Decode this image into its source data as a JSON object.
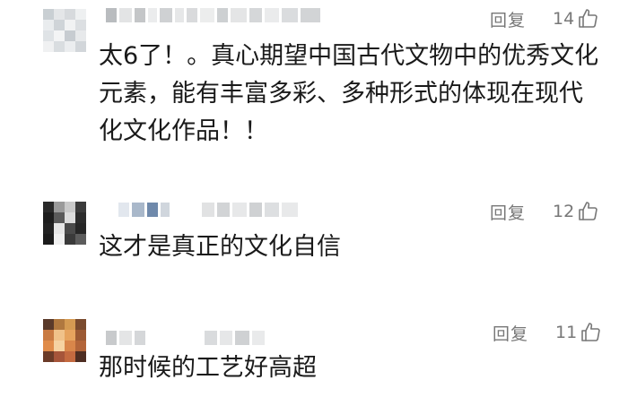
{
  "comments": [
    {
      "text": "太6了！。真心期望中国古代文物中的优秀文化元素，能有丰富多彩、多种形式的体现在现代化文化作品！！",
      "reply_label": "回复",
      "likes": "14"
    },
    {
      "text": "这才是真正的文化自信",
      "reply_label": "回复",
      "likes": "12"
    },
    {
      "text": "那时候的工艺好高超",
      "reply_label": "回复",
      "likes": "11"
    }
  ],
  "icons": {
    "like": "thumbs-up-icon"
  },
  "colors": {
    "text": "#1a1a1a",
    "meta": "#777777"
  }
}
